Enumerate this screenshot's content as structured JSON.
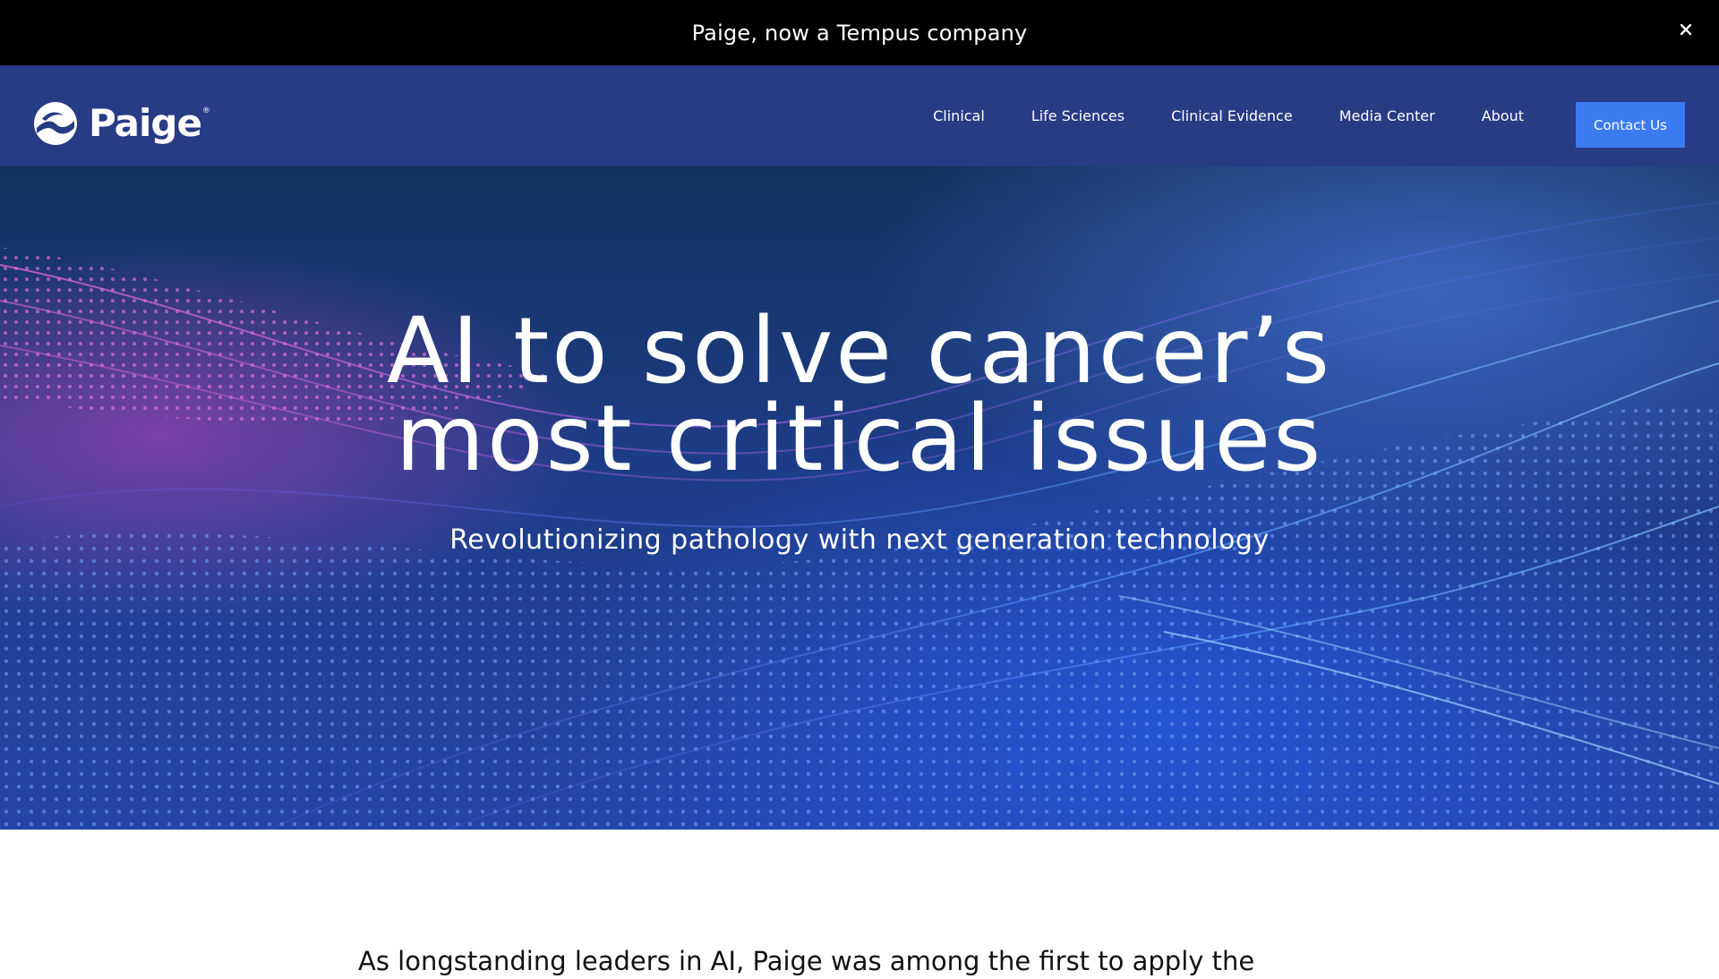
{
  "announcement": {
    "text": "Paige, now a Tempus company",
    "close_label": "×"
  },
  "header": {
    "logo_text": "Paige",
    "logo_reg": "®",
    "nav": [
      "Clinical",
      "Life Sciences",
      "Clinical Evidence",
      "Media Center",
      "About"
    ],
    "cta_label": "Contact Us"
  },
  "hero": {
    "title_line1": "AI to solve cancer’s",
    "title_line2": "most critical issues",
    "subtitle": "Revolutionizing pathology with next generation technology"
  },
  "intro": {
    "text": "As longstanding leaders in AI, Paige was among the first to apply the"
  },
  "colors": {
    "announcement_bg": "#000000",
    "header_bg": "#283b85",
    "cta_bg": "#3b7bf0",
    "wave_pink": "#e05ad0",
    "wave_blue": "#5aa0ff"
  },
  "icons": {
    "close": "close-icon",
    "logo": "paige-logo-mark"
  }
}
